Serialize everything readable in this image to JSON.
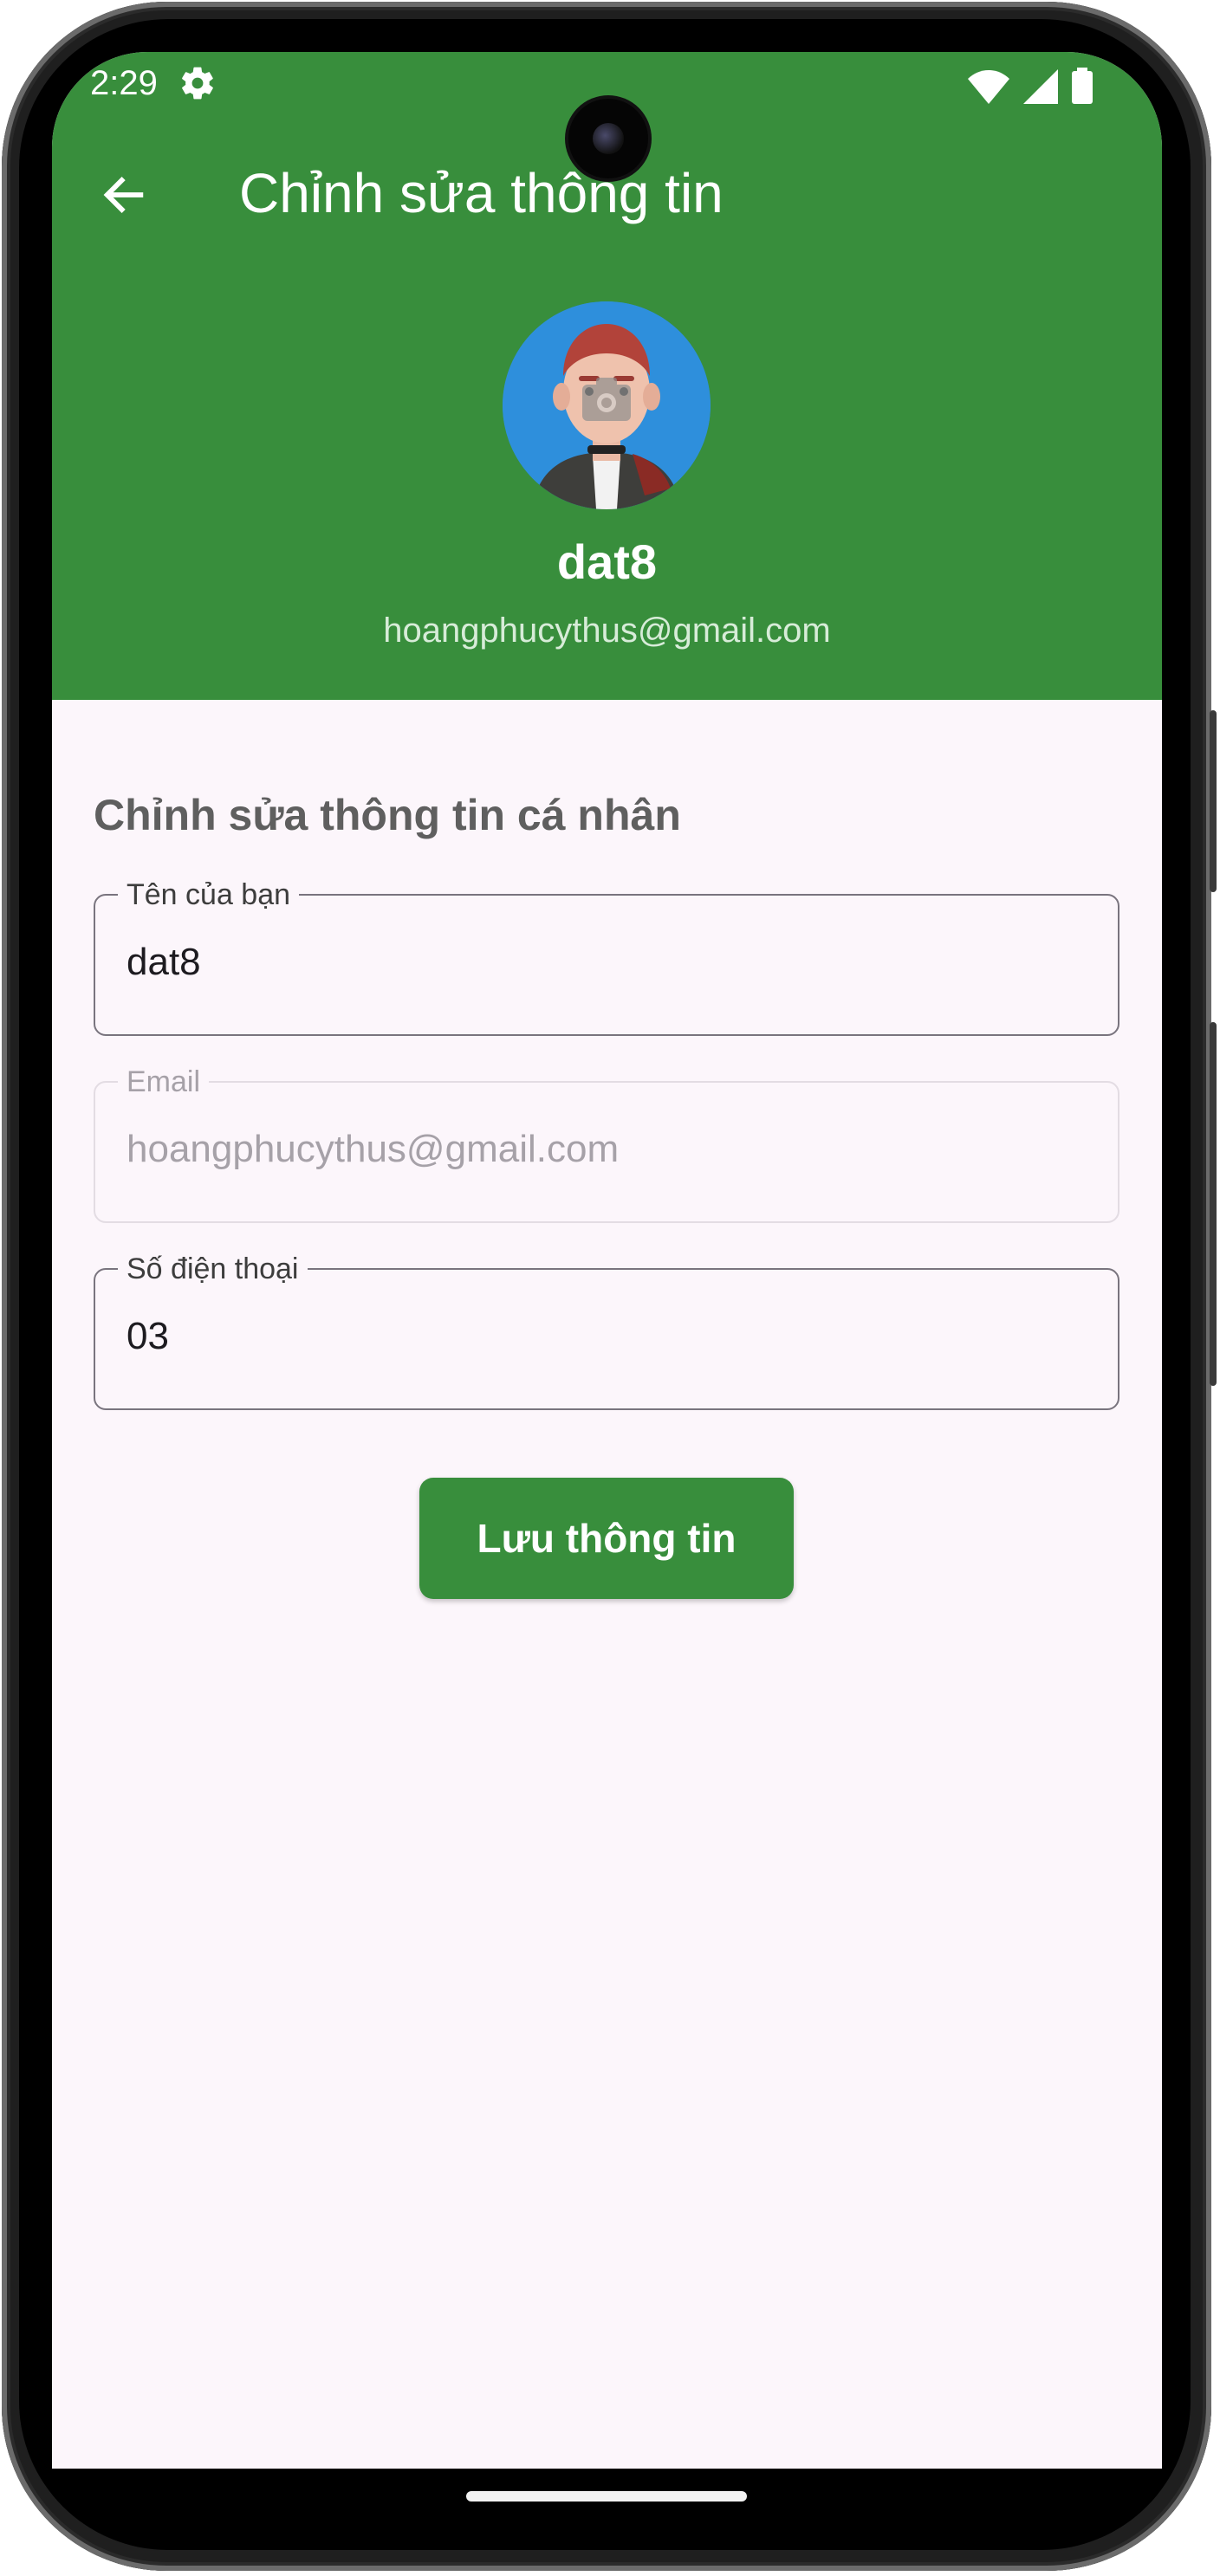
{
  "status_bar": {
    "time": "2:29",
    "icons": [
      "gear-icon",
      "wifi-icon",
      "signal-icon",
      "battery-icon"
    ]
  },
  "app_bar": {
    "title": "Chỉnh sửa thông tin",
    "back_icon": "arrow-back-icon"
  },
  "profile": {
    "name": "dat8",
    "email": "hoangphucythus@gmail.com",
    "avatar_overlay_icon": "camera-icon"
  },
  "form": {
    "section_title": "Chỉnh sửa thông tin cá nhân",
    "name_field": {
      "label": "Tên của bạn",
      "value": "dat8"
    },
    "email_field": {
      "label": "Email",
      "value": "hoangphucythus@gmail.com"
    },
    "phone_field": {
      "label": "Số điện thoại",
      "value": "03"
    },
    "save_button": "Lưu thông tin"
  },
  "colors": {
    "primary": "#388e3c",
    "background": "#fcf6fb",
    "section_title": "#5f5f5f",
    "field_border": "#79747e",
    "disabled_text": "#a6a1a8"
  }
}
